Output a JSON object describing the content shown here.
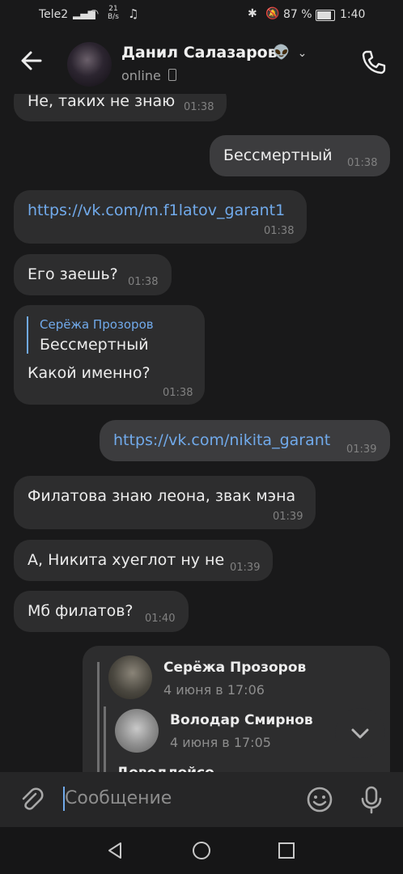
{
  "status_bar": {
    "carrier": "Tele2",
    "net_speed_value": "21",
    "net_speed_unit": "B/s",
    "battery": "87 %",
    "time": "1:40"
  },
  "header": {
    "contact_name": "Данил Салазаров",
    "presence": "online",
    "icons": [
      "back-arrow-icon",
      "alien-emoji-icon",
      "chevron-down-icon",
      "mobile-device-icon",
      "phone-call-icon"
    ]
  },
  "messages": [
    {
      "dir": "in",
      "text": "Не, таких не знаю",
      "time": "01:38"
    },
    {
      "dir": "out",
      "text": "Бессмертный",
      "time": "01:38"
    },
    {
      "dir": "in",
      "text": "https://vk.com/m.f1latov_garant1",
      "time": "01:38",
      "link": true
    },
    {
      "dir": "in",
      "text": "Его заешь?",
      "time": "01:38"
    },
    {
      "dir": "in",
      "reply_author": "Серёжа Прозоров",
      "reply_text": "Бессмертный",
      "text": "Какой именно?",
      "time": "01:38"
    },
    {
      "dir": "out",
      "text": "https://vk.com/nikita_garant",
      "time": "01:39",
      "link": true
    },
    {
      "dir": "in",
      "text": "Филатова знаю леона, звак мэна",
      "time": "01:39"
    },
    {
      "dir": "in",
      "text": "А, Никита хуеглот ну не",
      "time": "01:39"
    },
    {
      "dir": "in",
      "text": "Мб филатов?",
      "time": "01:40"
    }
  ],
  "forwarded": {
    "first": {
      "author": "Серёжа Прозоров",
      "date": "4 июня в 17:06"
    },
    "second": {
      "author": "Володар Смирнов",
      "date": "4 июня в 17:05"
    },
    "partial_text": "Доводлойсо"
  },
  "composer": {
    "placeholder": "Сообщение"
  },
  "colors": {
    "background": "#19191a",
    "bubble_in": "#2d2d2e",
    "bubble_out": "#3c3c3e",
    "link": "#71aaeb",
    "accent": "#71aaeb"
  }
}
